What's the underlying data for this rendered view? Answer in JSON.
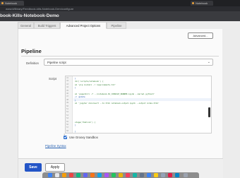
{
  "browser": {
    "tabs": [
      {
        "label": "Notebook"
      },
      {
        "label": "Notebook"
      }
    ],
    "url": "www.it/library/Feedbook-kills-Notebook-Dem/configure"
  },
  "breadcrumb": {
    "text": "book-Kills-Notebook-Demo"
  },
  "page_tabs": [
    {
      "label": "General"
    },
    {
      "label": "Build Triggers"
    },
    {
      "label": "Advanced Project Options"
    },
    {
      "label": "Pipeline"
    }
  ],
  "advanced_button": "Advanced...",
  "section": {
    "title": "Pipeline"
  },
  "definition": {
    "label": "Definition",
    "value": "Pipeline script"
  },
  "script": {
    "label": "Script",
    "lines": [
      {
        "num": "41",
        "text": "}"
      },
      {
        "num": "42",
        "text": "dir('scripts/notebook') {"
      },
      {
        "num": "43",
        "text": "  sh 'pip install -r requirements.txt'"
      },
      {
        "num": "44",
        "text": "}"
      },
      {
        "num": "45",
        "text": ""
      },
      {
        "num": "46",
        "text": "sh 'papermill -f ../notebook-01_CONSOLE_RUNNER.ipynb --kernel python3'"
      },
      {
        "num": "47",
        "text": "  // update"
      },
      {
        "num": "48",
        "text": "}"
      },
      {
        "num": "49",
        "text": "sh 'jupyter nbconvert --to html notebook-output.ipynb --output index.html'"
      },
      {
        "num": "50",
        "text": ""
      },
      {
        "num": "51",
        "text": ""
      },
      {
        "num": "52",
        "text": ""
      },
      {
        "num": "53",
        "text": ""
      },
      {
        "num": "54",
        "text": ""
      },
      {
        "num": "55",
        "text": "  stage('Publish') {"
      },
      {
        "num": "56",
        "text": "  }"
      },
      {
        "num": "57",
        "text": ""
      },
      {
        "num": "58",
        "text": "}"
      }
    ]
  },
  "sandbox": {
    "label": "Use Groovy Sandbox",
    "checked": true
  },
  "pipeline_syntax_link": "Pipeline Syntax",
  "buttons": {
    "save": "Save",
    "apply": "Apply"
  },
  "colors": {
    "primary": "#2355c7",
    "link": "#245fb0",
    "checkbox": "#2c6fd1"
  }
}
